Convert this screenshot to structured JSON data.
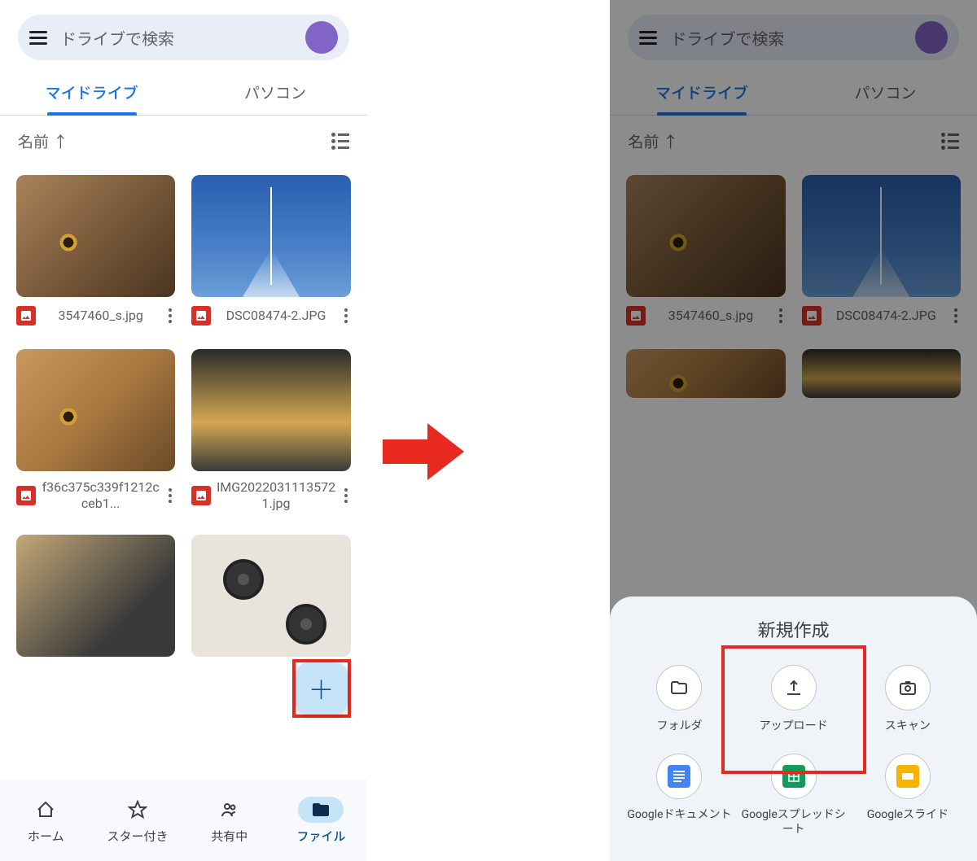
{
  "search": {
    "placeholder": "ドライブで検索"
  },
  "tabs": {
    "mydrive": "マイドライブ",
    "pc": "パソコン"
  },
  "sort": {
    "label": "名前 ↑"
  },
  "files": [
    {
      "name": "3547460_s.jpg"
    },
    {
      "name": "DSC08474-2.JPG"
    },
    {
      "name": "f36c375c339f1212cceb1..."
    },
    {
      "name": "IMG20220311135721.jpg"
    }
  ],
  "nav": {
    "home": "ホーム",
    "starred": "スター付き",
    "shared": "共有中",
    "files": "ファイル"
  },
  "sheet": {
    "title": "新規作成",
    "folder": "フォルダ",
    "upload": "アップロード",
    "scan": "スキャン",
    "docs": "Googleドキュメント",
    "sheets": "Googleスプレッドシート",
    "slides": "Googleスライド"
  }
}
